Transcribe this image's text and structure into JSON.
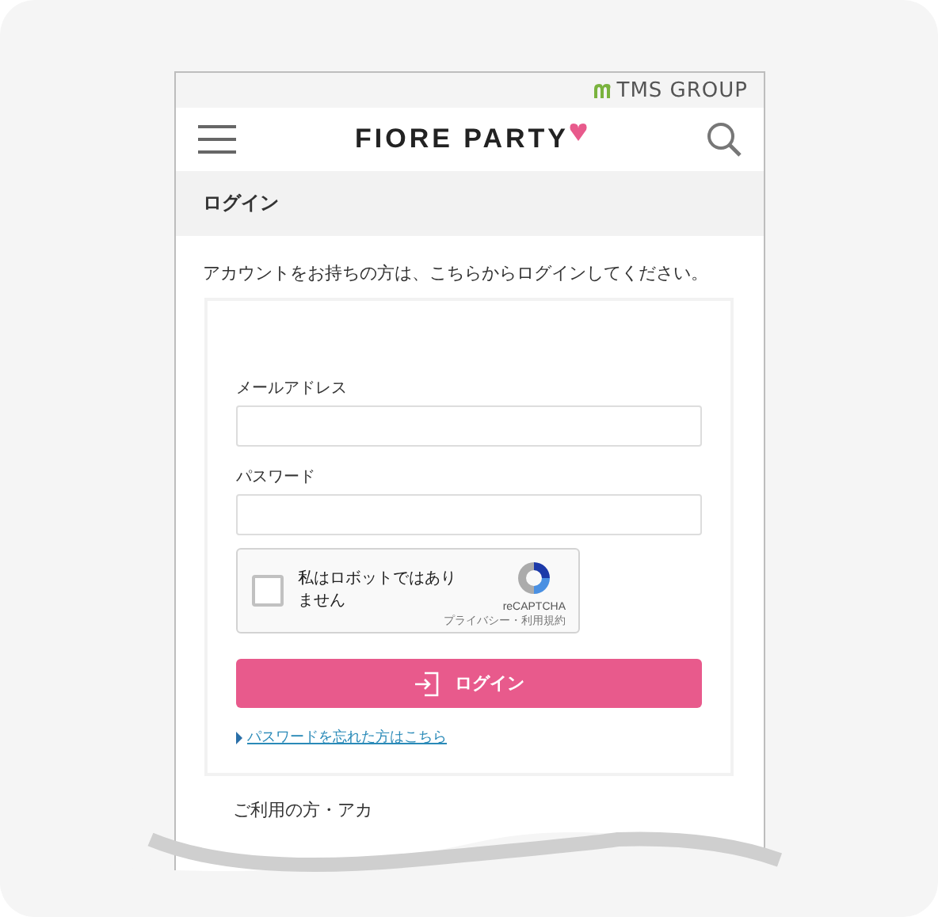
{
  "group_logo": "TMS GROUP",
  "brand_logo": "FIORE PARTY",
  "page_title": "ログイン",
  "intro": "アカウントをお持ちの方は、こちらからログインしてください。",
  "form": {
    "fields": [
      {
        "label": "メールアドレス"
      },
      {
        "label": "パスワード"
      }
    ],
    "captcha": {
      "checked": false,
      "label": "私はロボットではありません",
      "brand": "reCAPTCHA",
      "links": "プライバシー・利用規約"
    },
    "submit": "ログイン",
    "forgot_link": "パスワードを忘れた方はこちら"
  },
  "next_section": "ご利用の方・アカ"
}
